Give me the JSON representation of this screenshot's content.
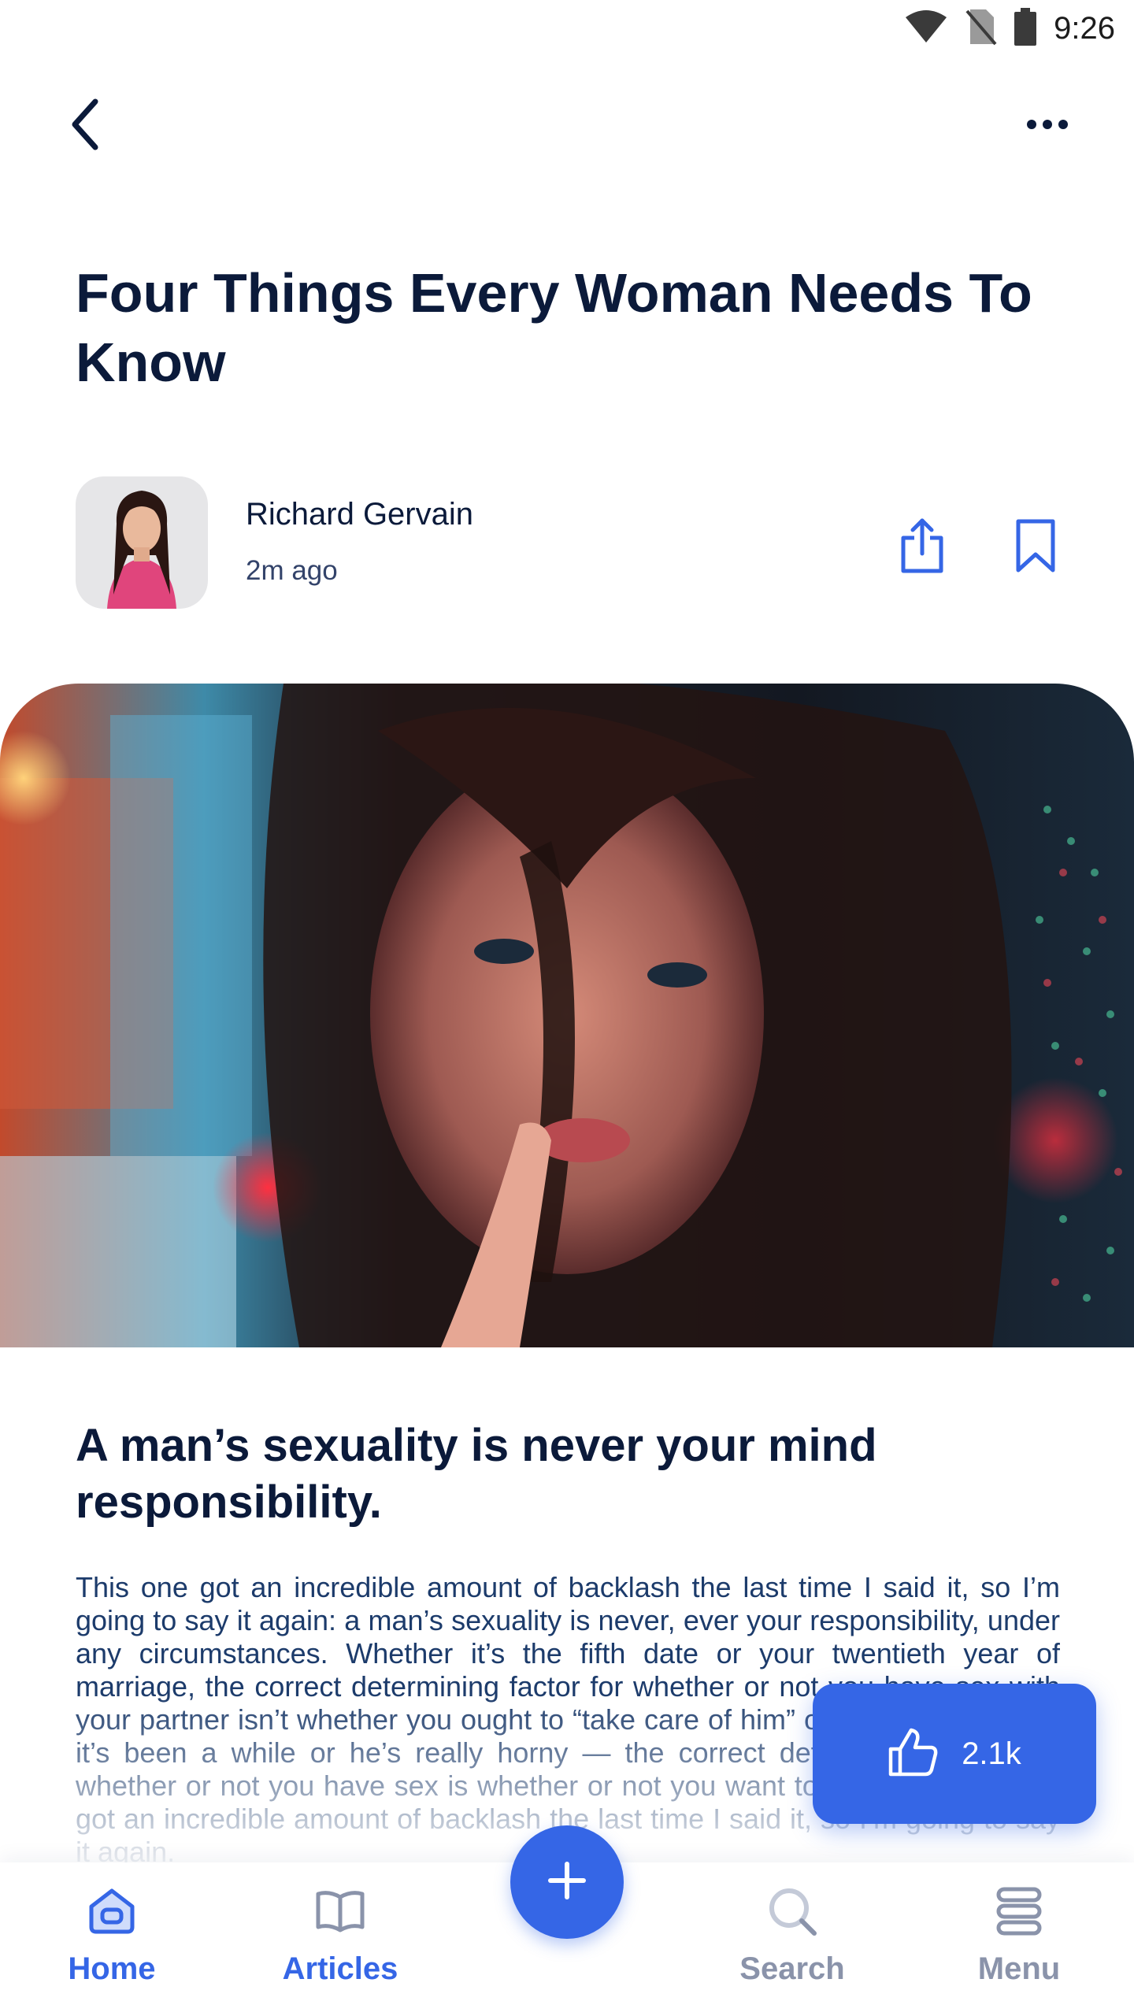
{
  "status_bar": {
    "time": "9:26",
    "icons": [
      "wifi-icon",
      "no-sim-icon",
      "battery-icon"
    ]
  },
  "top_bar": {
    "back_icon": "chevron-left-icon",
    "more_icon": "more-horizontal-icon"
  },
  "article": {
    "title": "Four Things Every Woman Needs To Know",
    "author": {
      "name": "Richard Gervain",
      "time": "2m ago"
    },
    "actions": {
      "share_icon": "share-icon",
      "bookmark_icon": "bookmark-icon"
    },
    "section_heading": "A man’s sexuality is never your mind responsibility.",
    "body": "This one got an incredible amount of backlash the last time I said it, so I’m going to say it again: a man’s sexuality is never, ever your responsibility, under any circumstances. Whether it’s the fifth date or your twentieth year of marriage, the correct determining factor for whether or not you have sex with your partner isn’t whether you ought to “take care of him” or “put out” because it’s been a while or he’s really horny — the correct determining factor for whether or not you have sex is whether or not you want to have sex.This one got an incredible amount of backlash the last time I said it, so I’m going to say it again."
  },
  "like": {
    "icon": "thumbs-up-icon",
    "count": "2.1k"
  },
  "bottom_nav": {
    "items": [
      {
        "label": "Home",
        "icon": "home-icon",
        "active": true
      },
      {
        "label": "Articles",
        "icon": "book-icon",
        "active": true
      },
      {
        "label": "Search",
        "icon": "search-icon",
        "active": false
      },
      {
        "label": "Menu",
        "icon": "menu-icon",
        "active": false
      }
    ],
    "fab_icon": "plus-icon"
  },
  "colors": {
    "primary": "#3566e6",
    "title": "#0b1a3a",
    "body_text": "#1c3b6b",
    "nav_inactive": "#8a93aa"
  }
}
